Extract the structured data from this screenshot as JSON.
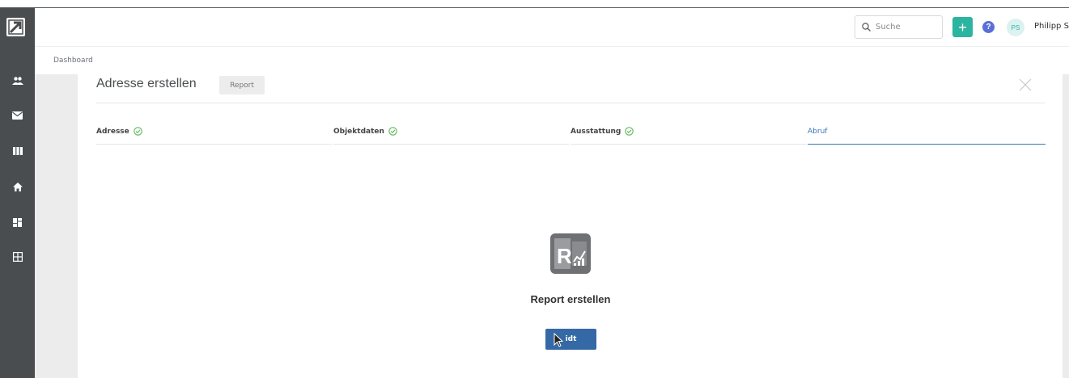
{
  "header": {
    "search_placeholder": "Suche",
    "add_label": "+",
    "help_label": "?",
    "avatar_initials": "PS",
    "user_name": "Philipp S"
  },
  "breadcrumb": "Dashboard",
  "dialog": {
    "title": "Adresse erstellen",
    "chip": "Report",
    "steps": [
      {
        "label": "Adresse",
        "done": true
      },
      {
        "label": "Objektdaten",
        "done": true
      },
      {
        "label": "Ausstattung",
        "done": true
      },
      {
        "label": "Abruf",
        "done": false,
        "active": true
      }
    ],
    "center_title": "Report erstellen",
    "button_label": "idt"
  },
  "colors": {
    "sidebar": "#4a4d50",
    "accent_teal": "#2bb5a0",
    "primary_blue": "#3569a6",
    "active_tab": "#3a78b8",
    "check_green": "#5cb85c"
  },
  "icons": {
    "sidebar": [
      "users-icon",
      "mail-icon",
      "columns-icon",
      "home-icon",
      "dashboard-icon",
      "grid-icon"
    ]
  }
}
